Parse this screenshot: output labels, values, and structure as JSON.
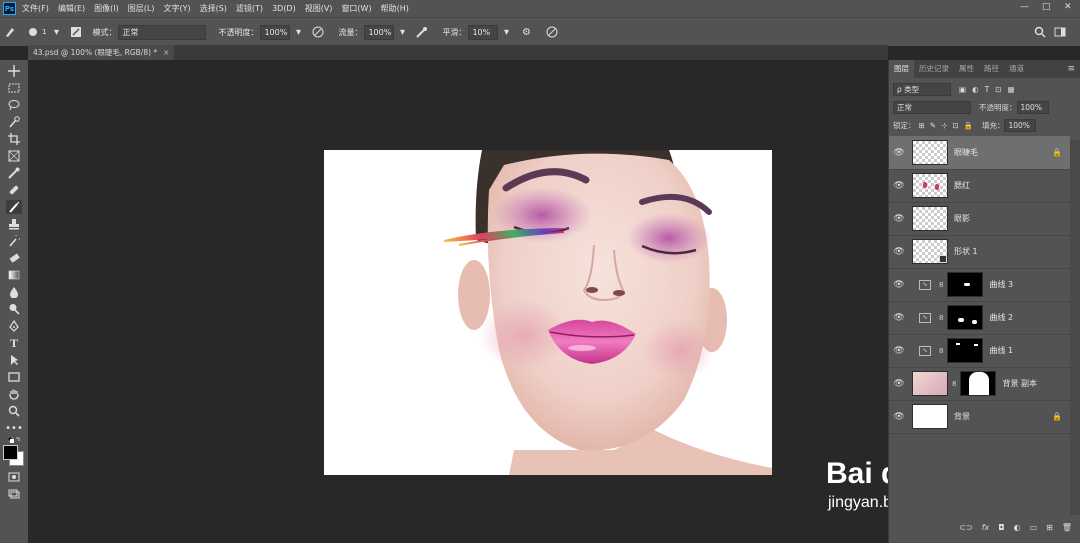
{
  "menubar": {
    "logo": "Ps",
    "items": [
      "文件(F)",
      "编辑(E)",
      "图像(I)",
      "图层(L)",
      "文字(Y)",
      "选择(S)",
      "滤镜(T)",
      "3D(D)",
      "视图(V)",
      "窗口(W)",
      "帮助(H)"
    ],
    "window_controls": [
      "—",
      "□",
      "✕"
    ]
  },
  "options": {
    "brush_size": "1",
    "mode_label": "模式：",
    "mode_value": "正常",
    "opacity_label": "不透明度：",
    "opacity_value": "100%",
    "flow_label": "流量：",
    "flow_value": "100%",
    "smoothing_label": "平滑：",
    "smoothing_value": "10%"
  },
  "document_tab": {
    "label": "43.psd @ 100% (眼睫毛, RGB/8) *",
    "close": "×"
  },
  "tools": [
    "move-tool",
    "marquee-tool",
    "lasso-tool",
    "quick-select-tool",
    "crop-tool",
    "frame-tool",
    "eyedropper-tool",
    "healing-tool",
    "brush-tool",
    "stamp-tool",
    "history-brush-tool",
    "eraser-tool",
    "gradient-tool",
    "blur-tool",
    "dodge-tool",
    "pen-tool",
    "type-tool",
    "path-select-tool",
    "shape-tool",
    "hand-tool",
    "zoom-tool",
    "more-tools"
  ],
  "layers_panel": {
    "tabs": [
      "图层",
      "历史记录",
      "属性",
      "路径",
      "通道"
    ],
    "filter_label": "ρ 类型",
    "blend_mode": "正常",
    "opacity_label": "不透明度：",
    "opacity_value": "100%",
    "lock_label": "锁定：",
    "fill_label": "填充：",
    "fill_value": "100%",
    "layers": [
      {
        "name": "眼睫毛",
        "selected": true,
        "locked": true
      },
      {
        "name": "腮红"
      },
      {
        "name": "眼影"
      },
      {
        "name": "形状 1"
      },
      {
        "name": "曲线 3"
      },
      {
        "name": "曲线 2"
      },
      {
        "name": "曲线 1"
      },
      {
        "name": "背景 副本"
      },
      {
        "name": "背景",
        "locked": true
      }
    ]
  },
  "watermark": {
    "logo": "Bai du 经验",
    "url": "jingyan.baidu.com"
  }
}
